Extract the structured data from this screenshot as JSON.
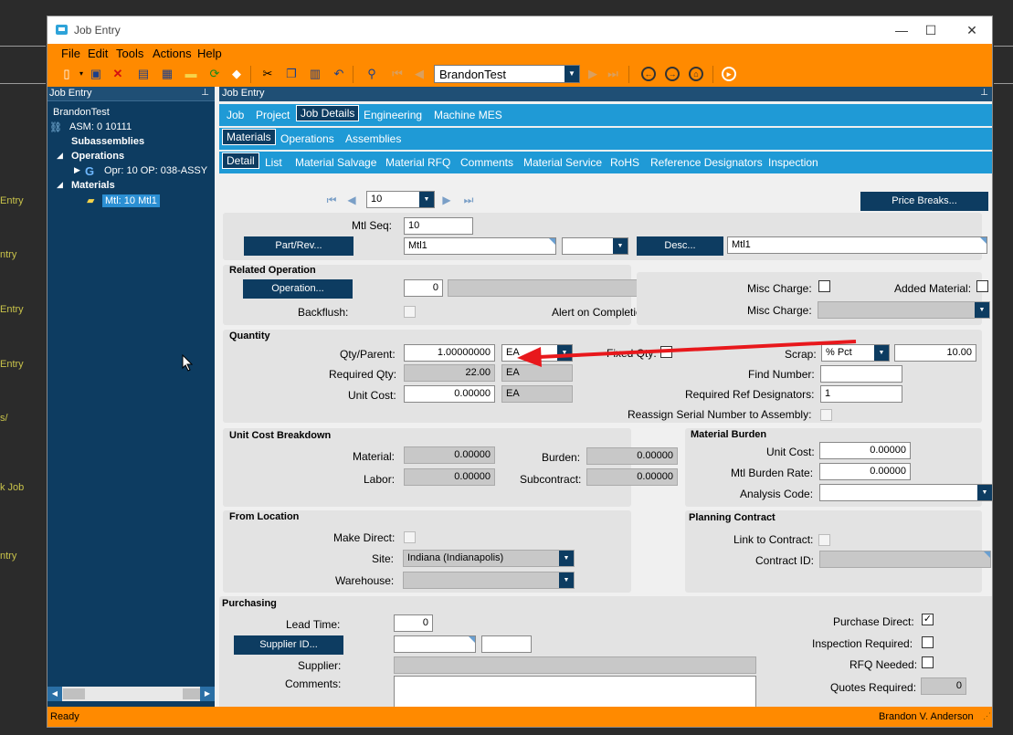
{
  "background": {
    "fragments": [
      "Entry",
      "ntry",
      "Entry",
      "Entry",
      "s/",
      "k Job",
      "ntry"
    ]
  },
  "window": {
    "title": "Job Entry",
    "buttons": {
      "minimize": "—",
      "maximize": "☐",
      "close": "✕"
    }
  },
  "menu": [
    "File",
    "Edit",
    "Tools",
    "Actions",
    "Help"
  ],
  "toolbar": {
    "combo_value": "BrandonTest"
  },
  "left_panel": {
    "title": "Job Entry",
    "tree": {
      "root": "BrandonTest",
      "asm": "ASM: 0 10111",
      "subassemblies": "Subassemblies",
      "operations": "Operations",
      "op_item": "Opr: 10 OP: 038-ASSY",
      "materials": "Materials",
      "mtl_item": "Mtl: 10 Mtl1"
    }
  },
  "right_panel": {
    "title": "Job Entry",
    "tabs1": [
      "Job",
      "Project",
      "Job Details",
      "Engineering",
      "Machine MES"
    ],
    "tabs2": [
      "Materials",
      "Operations",
      "Assemblies"
    ],
    "tabs3": [
      "Detail",
      "List",
      "Material Salvage",
      "Material RFQ",
      "Comments",
      "Material Service",
      "RoHS",
      "Reference Designators",
      "Inspection"
    ],
    "nav_value": "10",
    "price_breaks": "Price Breaks...",
    "mtl_seq_label": "Mtl Seq:",
    "mtl_seq": "10",
    "part_rev_btn": "Part/Rev...",
    "part": "Mtl1",
    "desc_btn": "Desc...",
    "desc": "Mtl1",
    "related_operation": {
      "title": "Related Operation",
      "operation_btn": "Operation...",
      "operation_value": "0",
      "backflush": "Backflush:",
      "alert": "Alert on Completion:"
    },
    "misc": {
      "misc_charge_label": "Misc Charge:",
      "added_material": "Added Material:",
      "misc_charge2": "Misc Charge:"
    },
    "quantity": {
      "title": "Quantity",
      "qty_parent": "Qty/Parent:",
      "qty_parent_value": "1.00000000",
      "qty_uom": "EA",
      "fixed_qty": "Fixed Qty:",
      "scrap": "Scrap:",
      "scrap_type": "% Pct",
      "scrap_value": "10.00",
      "required_qty": "Required Qty:",
      "required_qty_value": "22.00",
      "required_uom": "EA",
      "find_number": "Find Number:",
      "unit_cost": "Unit Cost:",
      "unit_cost_value": "0.00000",
      "unit_cost_uom": "EA",
      "req_ref_designators": "Required Ref Designators:",
      "req_ref_value": "1",
      "reassign_serial": "Reassign Serial Number to Assembly:"
    },
    "unit_cost_breakdown": {
      "title": "Unit Cost Breakdown",
      "material": "Material:",
      "material_value": "0.00000",
      "burden": "Burden:",
      "burden_value": "0.00000",
      "labor": "Labor:",
      "labor_value": "0.00000",
      "subcontract": "Subcontract:",
      "subcontract_value": "0.00000"
    },
    "material_burden": {
      "title": "Material Burden",
      "unit_cost": "Unit Cost:",
      "unit_cost_value": "0.00000",
      "burden_rate": "Mtl  Burden Rate:",
      "burden_rate_value": "0.00000",
      "analysis_code": "Analysis Code:"
    },
    "from_location": {
      "title": "From Location",
      "make_direct": "Make Direct:",
      "site": "Site:",
      "site_value": "Indiana (Indianapolis)",
      "warehouse": "Warehouse:"
    },
    "planning_contract": {
      "title": "Planning Contract",
      "link": "Link to Contract:",
      "contract_id": "Contract ID:"
    },
    "purchasing": {
      "title": "Purchasing",
      "lead_time": "Lead Time:",
      "lead_time_value": "0",
      "supplier_btn": "Supplier ID...",
      "supplier": "Supplier:",
      "comments": "Comments:",
      "purchase_direct": "Purchase Direct:",
      "inspection_required": "Inspection  Required:",
      "rfq_needed": "RFQ Needed:",
      "quotes_required": "Quotes Required:",
      "quotes_value": "0"
    }
  },
  "status": {
    "left": "Ready",
    "right": "Brandon V. Anderson"
  },
  "colors": {
    "orange": "#ff8a00",
    "navy": "#0d3c61",
    "tab_blue": "#1f9ad6",
    "arrow_red": "#e8181c"
  }
}
